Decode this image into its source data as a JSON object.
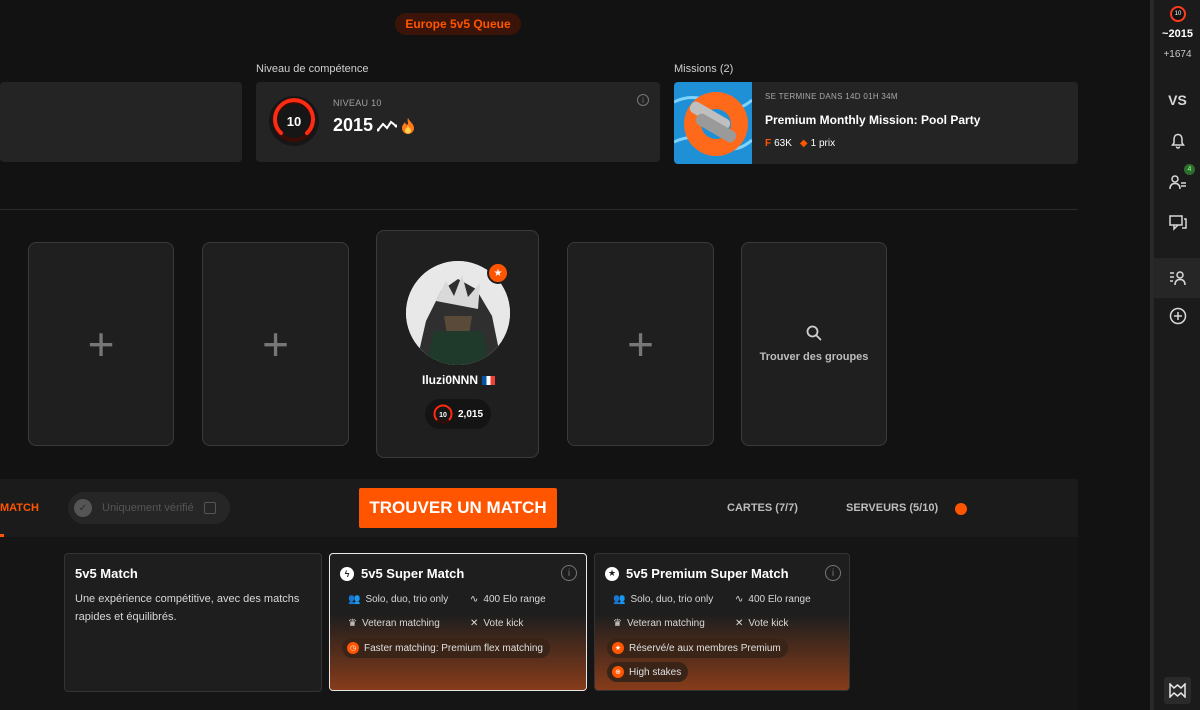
{
  "queue_label": "Europe 5v5 Queue",
  "skill": {
    "section_label": "Niveau de compétence",
    "level_label": "NIVEAU 10",
    "level_number": "10",
    "elo": "2015"
  },
  "missions": {
    "section_label": "Missions (2)",
    "ends_in": "SE TERMINE DANS 14D 01H 34M",
    "title": "Premium Monthly Mission: Pool Party",
    "reward_points": "63K",
    "reward_prizes": "1 prix"
  },
  "party": {
    "player_name": "Iluzi0NNN",
    "player_level": "10",
    "player_elo": "2,015",
    "find_groups_label": "Trouver des groupes"
  },
  "queue_bar": {
    "match_tab": "MATCH",
    "verified_only_label": "Uniquement vérifié",
    "find_match_label": "TROUVER UN MATCH",
    "maps_label": "CARTES (7/7)",
    "servers_label": "SERVEURS (5/10)"
  },
  "modes": [
    {
      "title": "5v5 Match",
      "description": "Une expérience compétitive, avec des matchs rapides et équilibrés."
    },
    {
      "title": "5v5 Super Match",
      "features": [
        "Solo, duo, trio only",
        "400 Elo range",
        "Veteran matching",
        "Vote kick"
      ],
      "highlight": "Faster matching: Premium flex matching"
    },
    {
      "title": "5v5 Premium Super Match",
      "features": [
        "Solo, duo, trio only",
        "400 Elo range",
        "Veteran matching",
        "Vote kick"
      ],
      "highlight_1": "Réservé/e aux membres Premium",
      "highlight_2": "High stakes"
    }
  ],
  "sidebar": {
    "level": "10",
    "elo": "2015",
    "elo_gain": "+1674",
    "vs_label": "VS",
    "friends_count": "4"
  },
  "colors": {
    "accent": "#ff5500",
    "background": "#121212",
    "panel": "#242424"
  }
}
